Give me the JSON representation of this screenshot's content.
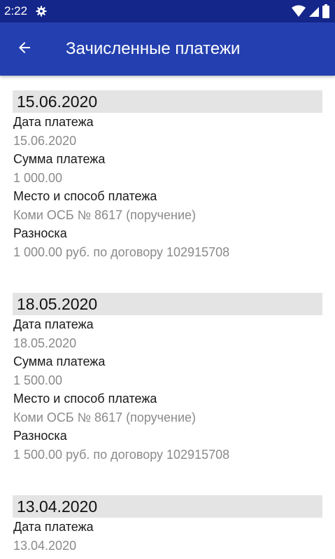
{
  "status_bar": {
    "time": "2:22",
    "icons": [
      "gear-icon",
      "wifi-icon",
      "signal-icon",
      "battery-icon"
    ]
  },
  "app_bar": {
    "title": "Зачисленные платежи",
    "back_icon": "arrow-left-icon",
    "color": "#2440b0"
  },
  "payments": [
    {
      "header": "15.06.2020",
      "date_label": "Дата платежа",
      "date_value": "15.06.2020",
      "amount_label": "Сумма платежа",
      "amount_value": "1 000.00",
      "place_label": "Место и способ платежа",
      "place_value": "Коми ОСБ № 8617 (поручение)",
      "allocation_label": "Разноска",
      "allocation_value": "1 000.00 руб. по договору 102915708"
    },
    {
      "header": "18.05.2020",
      "date_label": "Дата платежа",
      "date_value": "18.05.2020",
      "amount_label": "Сумма платежа",
      "amount_value": "1 500.00",
      "place_label": "Место и способ платежа",
      "place_value": "Коми ОСБ № 8617 (поручение)",
      "allocation_label": "Разноска",
      "allocation_value": "1 500.00 руб. по договору 102915708"
    },
    {
      "header": "13.04.2020",
      "date_label": "Дата платежа",
      "date_value": "13.04.2020"
    }
  ]
}
